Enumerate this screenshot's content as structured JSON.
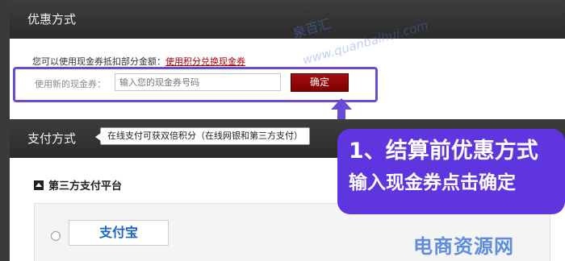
{
  "discount": {
    "header": "优惠方式",
    "hint_prefix": "您可以使用现金券抵扣部分金额：",
    "hint_link": "使用积分兑换现金券",
    "coupon_label": "使用新的现金券：",
    "coupon_placeholder": "输入您的现金券号码",
    "confirm_label": "确定"
  },
  "payment": {
    "header": "支付方式",
    "tip": "在线支付可获双倍积分（在线网银和第三方支付）",
    "third_party_title": "第三方支付平台",
    "alipay_logo": "支付宝"
  },
  "callout": {
    "line1": "1、结算前优惠方式",
    "line2": "输入现金券点击确定"
  },
  "watermark": {
    "text1": "泉百汇",
    "text2": "www.quanbaihui.com",
    "brand": "电商资源网"
  },
  "colors": {
    "highlight_border": "#6a4bd6",
    "callout_bg": "#5f35e0",
    "confirm_bg": "#8b0000",
    "header_bg": "#333333"
  }
}
